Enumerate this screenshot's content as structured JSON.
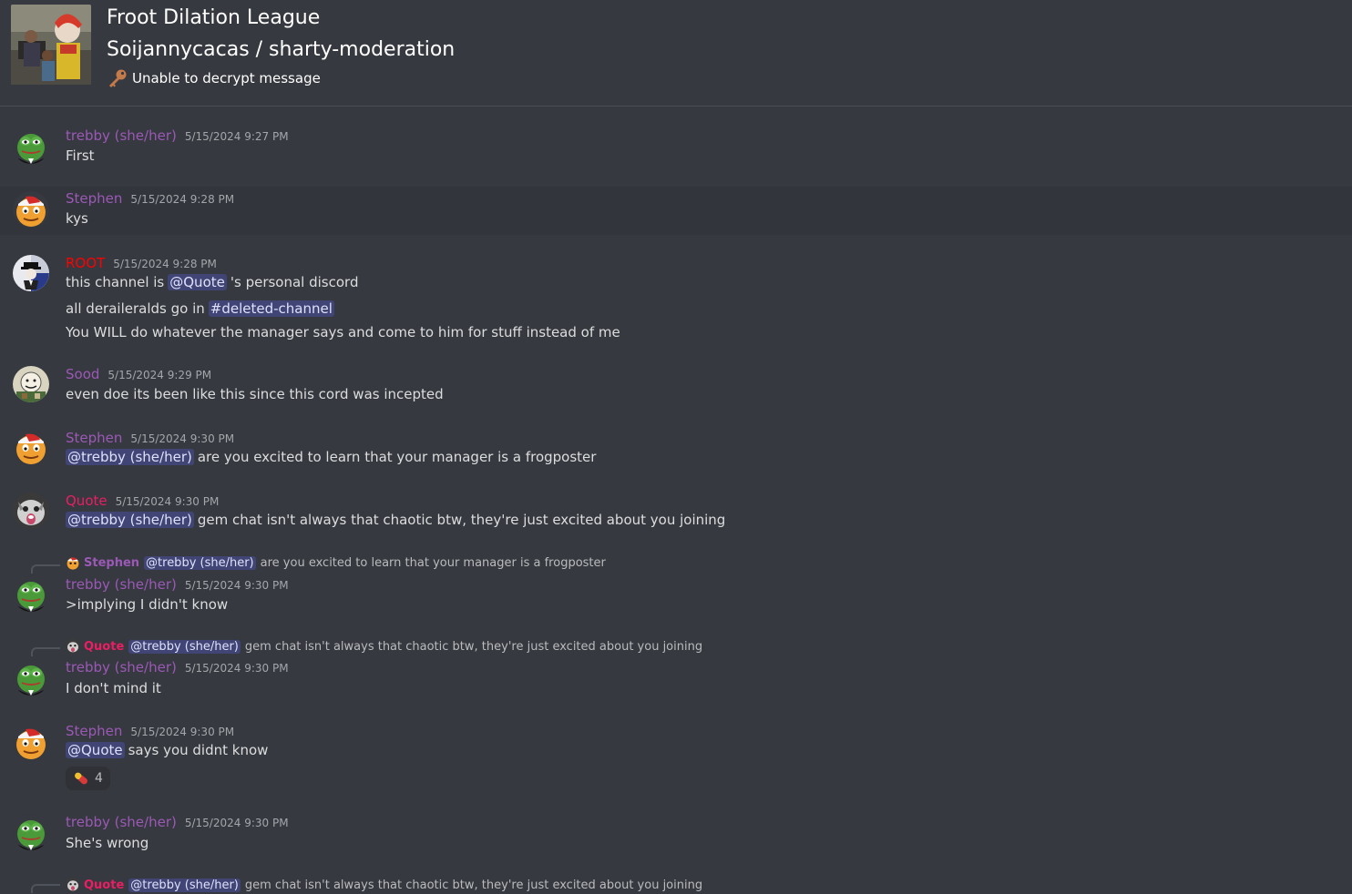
{
  "header": {
    "guild_name": "Froot Dilation League",
    "channel_path": "Soijannycacas / sharty-moderation",
    "topic": "Unable to decrypt message"
  },
  "colors": {
    "purple_role": "#9b59b6",
    "red_role": "#ff0000",
    "pink_role": "#e91e63",
    "mention_bg": "#414675",
    "background": "#36393f"
  },
  "messages": [
    {
      "author": "trebby (she/her)",
      "timestamp": "5/15/2024 9:27 PM",
      "lines": [
        "First"
      ]
    },
    {
      "author": "Stephen",
      "timestamp": "5/15/2024 9:28 PM",
      "lines": [
        "kys"
      ]
    },
    {
      "author": "ROOT",
      "timestamp": "5/15/2024 9:28 PM",
      "line1_pre": "this channel is",
      "line1_mention": "@Quote",
      "line1_post": "'s personal discord",
      "line2_pre": "all deraileralds go in",
      "line2_channel": "#deleted-channel",
      "line3": "You WILL do whatever the manager says and come to him for stuff instead of me"
    },
    {
      "author": "Sood",
      "timestamp": "5/15/2024 9:29 PM",
      "lines": [
        "even doe its been like this since this cord was incepted"
      ]
    },
    {
      "author": "Stephen",
      "timestamp": "5/15/2024 9:30 PM",
      "mention": "@trebby (she/her)",
      "text": "are you excited to learn that your manager is a frogposter"
    },
    {
      "author": "Quote",
      "timestamp": "5/15/2024 9:30 PM",
      "mention": "@trebby (she/her)",
      "text": "gem chat isn't always that chaotic btw, they're just excited about you joining"
    },
    {
      "reply_author": "Stephen",
      "reply_mention": "@trebby (she/her)",
      "reply_text": "are you excited to learn that your manager is a frogposter",
      "author": "trebby (she/her)",
      "timestamp": "5/15/2024 9:30 PM",
      "lines": [
        ">implying I didn't know"
      ]
    },
    {
      "reply_author": "Quote",
      "reply_mention": "@trebby (she/her)",
      "reply_text": "gem chat isn't always that chaotic btw, they're just excited about you joining",
      "author": "trebby (she/her)",
      "timestamp": "5/15/2024 9:30 PM",
      "lines": [
        "I don't mind it"
      ]
    },
    {
      "author": "Stephen",
      "timestamp": "5/15/2024 9:30 PM",
      "mention": "@Quote",
      "text": "says you didnt know",
      "reaction_emoji": "pill-emoji",
      "reaction_count": "4"
    },
    {
      "author": "trebby (she/her)",
      "timestamp": "5/15/2024 9:30 PM",
      "lines": [
        "She's wrong"
      ]
    },
    {
      "reply_author": "Quote",
      "reply_mention": "@trebby (she/her)",
      "reply_text": "gem chat isn't always that chaotic btw, they're just excited about you joining"
    }
  ]
}
